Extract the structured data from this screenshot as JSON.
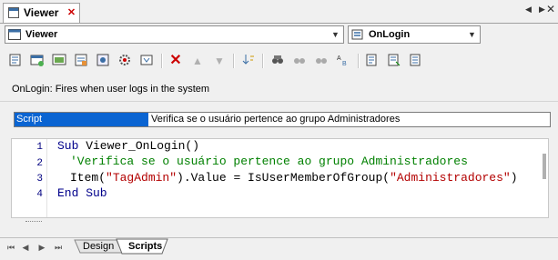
{
  "tab": {
    "title": "Viewer"
  },
  "object_selector": {
    "value": "Viewer"
  },
  "event_selector": {
    "value": "OnLogin"
  },
  "event_description": "OnLogin: Fires when user logs in the system",
  "event_row": {
    "name": "Script",
    "description": "Verifica se o usuário pertence ao grupo Administradores"
  },
  "code": {
    "line_numbers": [
      "1",
      "2",
      "3",
      "4"
    ],
    "line1": {
      "kw": "Sub",
      "rest": " Viewer_OnLogin()"
    },
    "line2": {
      "comment": "'Verifica se o usuário pertence ao grupo Administradores"
    },
    "line3": {
      "a": "Item(",
      "s1": "\"TagAdmin\"",
      "b": ").Value = IsUserMemberOfGroup(",
      "s2": "\"Administradores\"",
      "c": ")"
    },
    "line4": {
      "kw": "End Sub"
    }
  },
  "bottom_tabs": {
    "design": "Design",
    "scripts": "Scripts"
  },
  "colors": {
    "selection": "#0a64d2",
    "keyword": "#00008b",
    "comment": "#008000",
    "string": "#b30000"
  }
}
